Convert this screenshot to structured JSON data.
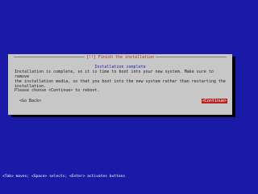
{
  "dialog": {
    "title": "[!!] Finish the installation",
    "subheading": "Installation complete",
    "message": "Installation is complete, so it is time to boot into your new system. Make sure to remove\nthe installation media, so that you boot into the new system rather than restarting the\ninstallation.",
    "prompt": "Please choose <Continue> to reboot.",
    "go_back_label": "<Go Back>",
    "continue_label": "<Continue>"
  },
  "help_bar": {
    "text": "<Tab> moves; <Space> selects; <Enter> activates buttons"
  },
  "colors": {
    "background": "#1a1aa8",
    "dialog": "#c7c7c7",
    "accent": "#b22222"
  }
}
